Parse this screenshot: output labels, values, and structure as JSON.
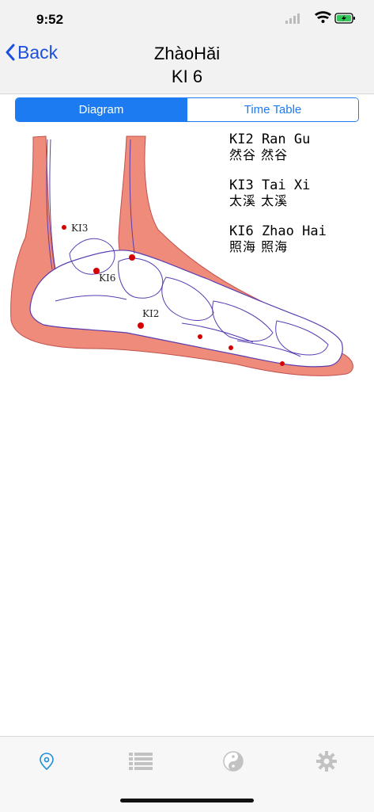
{
  "status_bar": {
    "time": "9:52"
  },
  "nav": {
    "back_label": "Back",
    "title_line1": "ZhàoHǎi",
    "title_line2": "KI 6"
  },
  "segments": {
    "diagram": "Diagram",
    "time_table": "Time Table",
    "selected": "Diagram"
  },
  "diagram": {
    "legend": [
      {
        "code": "KI2 Ran Gu",
        "chinese": "然谷  然谷"
      },
      {
        "code": "KI3 Tai Xi",
        "chinese": "太溪  太溪"
      },
      {
        "code": "KI6 Zhao Hai",
        "chinese": "照海  照海"
      }
    ],
    "labels": {
      "ki3": "KI3",
      "ki6": "KI6",
      "ki2": "KI2"
    }
  },
  "tabs": [
    {
      "name": "location",
      "icon": "location-pin-icon",
      "selected": true
    },
    {
      "name": "list",
      "icon": "list-icon",
      "selected": false
    },
    {
      "name": "yin-yang",
      "icon": "yin-yang-icon",
      "selected": false
    },
    {
      "name": "settings",
      "icon": "gear-icon",
      "selected": false
    }
  ],
  "colors": {
    "accent": "#1c7bf0",
    "back": "#1a4fe0",
    "meridian": "#ef8b7a",
    "point": "#d40000",
    "bone_line": "#5a3db0"
  }
}
